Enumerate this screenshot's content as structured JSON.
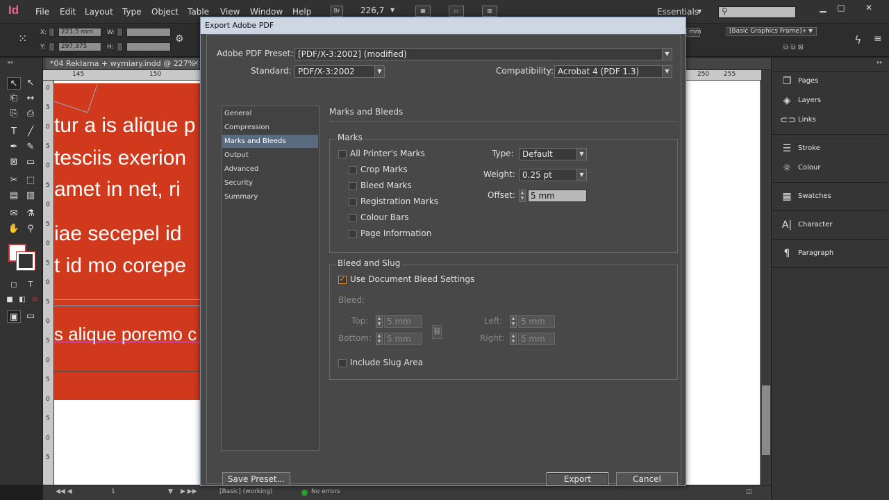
{
  "menubar": {
    "logo": "Id",
    "items": [
      "File",
      "Edit",
      "Layout",
      "Type",
      "Object",
      "Table",
      "View",
      "Window",
      "Help"
    ],
    "bridge": "Br",
    "zoom": "226,7",
    "workspace": "Essentials"
  },
  "controlbar": {
    "x_label": "X:",
    "x_value": "221,5 mm",
    "y_label": "Y:",
    "y_value": "297,375 mm",
    "w_label": "W:",
    "h_label": "H:",
    "right_value": "mm",
    "object_style": "[Basic Graphics Frame]+"
  },
  "document": {
    "tab_title": "*04 Reklama + wymiary.indd @ 227%",
    "ruler_h": [
      "145",
      "150",
      "250",
      "255"
    ],
    "ruler_v": [
      "0",
      "5",
      "0",
      "5",
      "0",
      "5",
      "0",
      "5",
      "0",
      "5",
      "0",
      "5",
      "0",
      "5",
      "0",
      "5",
      "0",
      "5",
      "0",
      "5"
    ],
    "text_lines": [
      "tur a is alique p",
      "tesciis exerion",
      "amet in net, ri",
      "iae secepel id",
      "t id mo corepe",
      "s alique poremo c"
    ],
    "colors": {
      "red": "#d0391c",
      "white": "#ffffff"
    }
  },
  "statusbar": {
    "page": "1",
    "profile": "[Basic] (working)",
    "errors": "No errors"
  },
  "panels": [
    {
      "label": "Pages",
      "icon": "pages-icon"
    },
    {
      "label": "Layers",
      "icon": "layers-icon"
    },
    {
      "label": "Links",
      "icon": "links-icon"
    },
    {
      "label": "Stroke",
      "icon": "stroke-icon"
    },
    {
      "label": "Colour",
      "icon": "colour-icon"
    },
    {
      "label": "Swatches",
      "icon": "swatches-icon"
    },
    {
      "label": "Character",
      "icon": "character-icon"
    },
    {
      "label": "Paragraph",
      "icon": "paragraph-icon"
    }
  ],
  "dialog": {
    "title": "Export Adobe PDF",
    "preset_label": "Adobe PDF Preset:",
    "preset_value": "[PDF/X-3:2002] (modified)",
    "standard_label": "Standard:",
    "standard_value": "PDF/X-3:2002",
    "compat_label": "Compatibility:",
    "compat_value": "Acrobat 4 (PDF 1.3)",
    "categories": [
      "General",
      "Compression",
      "Marks and Bleeds",
      "Output",
      "Advanced",
      "Security",
      "Summary"
    ],
    "selected_category": "Marks and Bleeds",
    "section_title": "Marks and Bleeds",
    "marks": {
      "group_title": "Marks",
      "all_printers": "All Printer's Marks",
      "crop": "Crop Marks",
      "bleed": "Bleed Marks",
      "registration": "Registration Marks",
      "colour_bars": "Colour Bars",
      "page_info": "Page Information",
      "type_label": "Type:",
      "type_value": "Default",
      "weight_label": "Weight:",
      "weight_value": "0.25 pt",
      "offset_label": "Offset:",
      "offset_value": "5 mm"
    },
    "bleed_slug": {
      "group_title": "Bleed and Slug",
      "use_doc_bleed": "Use Document Bleed Settings",
      "bleed_label": "Bleed:",
      "top_label": "Top:",
      "top_value": "5 mm",
      "bottom_label": "Bottom:",
      "bottom_value": "5 mm",
      "left_label": "Left:",
      "left_value": "5 mm",
      "right_label": "Right:",
      "right_value": "5 mm",
      "include_slug": "Include Slug Area"
    },
    "buttons": {
      "save_preset": "Save Preset...",
      "export": "Export",
      "cancel": "Cancel"
    },
    "checkmark": "✓"
  }
}
